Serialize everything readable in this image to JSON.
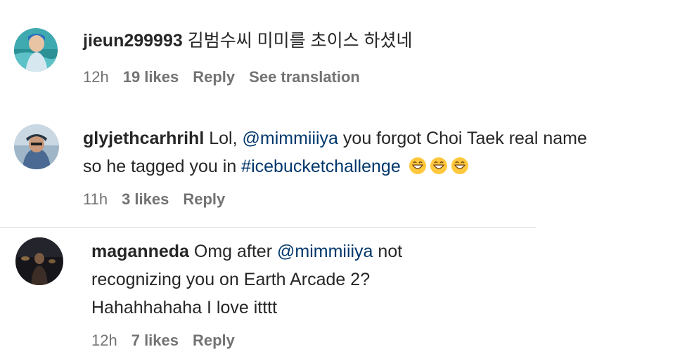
{
  "comments": [
    {
      "username": "jieun299993",
      "text": "김범수씨 미미를 초이스 하셨네",
      "time": "12h",
      "likes": "19 likes",
      "reply": "Reply",
      "translate": "See translation"
    },
    {
      "username": "glyjethcarhrihl",
      "text_before": "Lol, ",
      "mention": "@mimmiiiya",
      "text_middle": " you forgot Choi Taek real name so he tagged you in ",
      "hashtag": "#icebucketchallenge",
      "emojis": [
        "grinning-face-icon",
        "grinning-face-icon",
        "grinning-face-icon"
      ],
      "time": "11h",
      "likes": "3 likes",
      "reply": "Reply"
    },
    {
      "username": "maganneda",
      "text_before": "Omg after ",
      "mention": "@mimmiiiya",
      "text_after": " not recognizing you on Earth Arcade 2? Hahahhahaha I love itttt",
      "time": "12h",
      "likes": "7 likes",
      "reply": "Reply"
    }
  ],
  "colors": {
    "text": "#262626",
    "link": "#00376b",
    "meta": "#737373",
    "divider": "#dbdbdb"
  }
}
